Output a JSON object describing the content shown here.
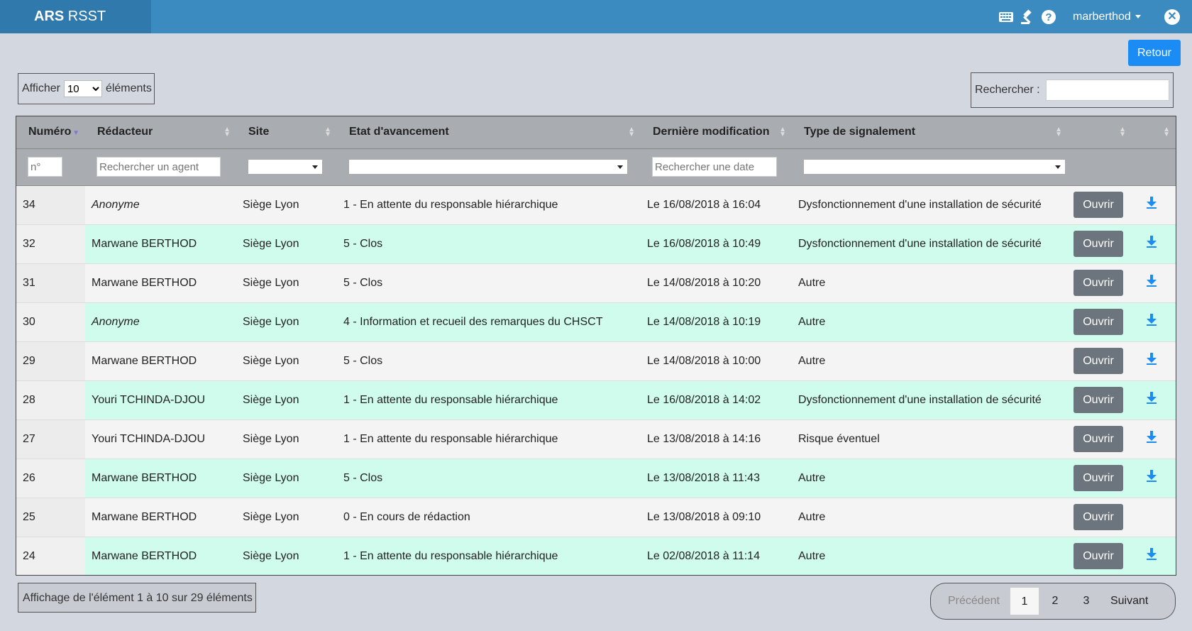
{
  "app": {
    "brand_bold": "ARS",
    "brand_rest": " RSST"
  },
  "header": {
    "username": "marberthod",
    "close_label": "✕"
  },
  "actions": {
    "retour_label": "Retour"
  },
  "length_menu": {
    "prefix": "Afficher",
    "value": "10",
    "suffix": "éléments"
  },
  "search": {
    "label": "Rechercher :",
    "value": ""
  },
  "table": {
    "columns": [
      "Numéro",
      "Rédacteur",
      "Site",
      "Etat d'avancement",
      "Dernière modification",
      "Type de signalement",
      "",
      ""
    ],
    "filters": {
      "numero_placeholder": "n°",
      "agent_placeholder": "Rechercher un agent",
      "date_placeholder": "Rechercher une date"
    },
    "open_label": "Ouvrir",
    "rows": [
      {
        "numero": "34",
        "redacteur": "Anonyme",
        "anonymous": true,
        "site": "Siège Lyon",
        "etat": "1 - En attente du responsable hiérarchique",
        "modif": "Le 16/08/2018 à 16:04",
        "type": "Dysfonctionnement d'une installation de sécurité",
        "download": true
      },
      {
        "numero": "32",
        "redacteur": "Marwane BERTHOD",
        "anonymous": false,
        "site": "Siège Lyon",
        "etat": "5 - Clos",
        "modif": "Le 16/08/2018 à 10:49",
        "type": "Dysfonctionnement d'une installation de sécurité",
        "download": true
      },
      {
        "numero": "31",
        "redacteur": "Marwane BERTHOD",
        "anonymous": false,
        "site": "Siège Lyon",
        "etat": "5 - Clos",
        "modif": "Le 14/08/2018 à 10:20",
        "type": "Autre",
        "download": true
      },
      {
        "numero": "30",
        "redacteur": "Anonyme",
        "anonymous": true,
        "site": "Siège Lyon",
        "etat": "4 - Information et recueil des remarques du CHSCT",
        "modif": "Le 14/08/2018 à 10:19",
        "type": "Autre",
        "download": true
      },
      {
        "numero": "29",
        "redacteur": "Marwane BERTHOD",
        "anonymous": false,
        "site": "Siège Lyon",
        "etat": "5 - Clos",
        "modif": "Le 14/08/2018 à 10:00",
        "type": "Autre",
        "download": true
      },
      {
        "numero": "28",
        "redacteur": "Youri TCHINDA-DJOU",
        "anonymous": false,
        "site": "Siège Lyon",
        "etat": "1 - En attente du responsable hiérarchique",
        "modif": "Le 16/08/2018 à 14:02",
        "type": "Dysfonctionnement d'une installation de sécurité",
        "download": true
      },
      {
        "numero": "27",
        "redacteur": "Youri TCHINDA-DJOU",
        "anonymous": false,
        "site": "Siège Lyon",
        "etat": "1 - En attente du responsable hiérarchique",
        "modif": "Le 13/08/2018 à 14:16",
        "type": "Risque éventuel",
        "download": true
      },
      {
        "numero": "26",
        "redacteur": "Marwane BERTHOD",
        "anonymous": false,
        "site": "Siège Lyon",
        "etat": "5 - Clos",
        "modif": "Le 13/08/2018 à 11:43",
        "type": "Autre",
        "download": true
      },
      {
        "numero": "25",
        "redacteur": "Marwane BERTHOD",
        "anonymous": false,
        "site": "Siège Lyon",
        "etat": "0 - En cours de rédaction",
        "modif": "Le 13/08/2018 à 09:10",
        "type": "Autre",
        "download": false
      },
      {
        "numero": "24",
        "redacteur": "Marwane BERTHOD",
        "anonymous": false,
        "site": "Siège Lyon",
        "etat": "1 - En attente du responsable hiérarchique",
        "modif": "Le 02/08/2018 à 11:14",
        "type": "Autre",
        "download": true
      }
    ]
  },
  "info": "Affichage de l'élément 1 à 10 sur 29 éléments",
  "pagination": {
    "previous": "Précédent",
    "pages": [
      "1",
      "2",
      "3"
    ],
    "current": "1",
    "next": "Suivant"
  },
  "colors": {
    "topbar": "#3b8bc0",
    "brand_bg": "#2f79ac",
    "row_alt": "#cffcec",
    "primary_btn": "#1b8cf3",
    "open_btn": "#6c757d"
  }
}
